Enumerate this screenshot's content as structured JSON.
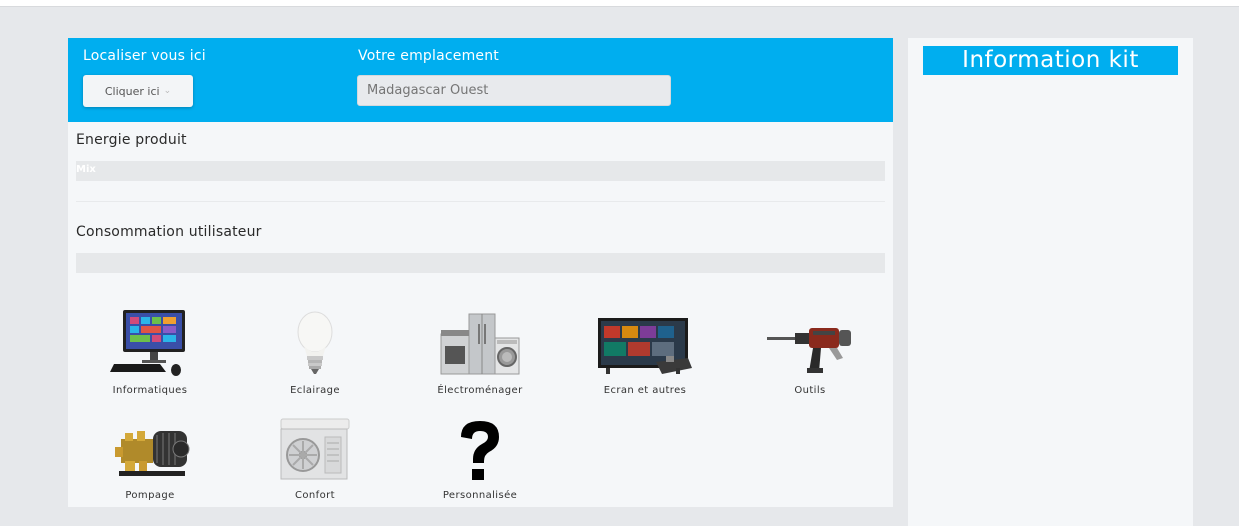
{
  "header": {
    "locate_label": "Localiser vous ici",
    "locate_button": "Cliquer ici",
    "location_label": "Votre emplacement",
    "location_placeholder": "Madagascar Ouest"
  },
  "energy": {
    "title": "Energie produit",
    "bar_text": "Mix"
  },
  "consumption": {
    "title": "Consommation utilisateur"
  },
  "categories": [
    {
      "label": "Informatiques",
      "icon": "computer-icon"
    },
    {
      "label": "Eclairage",
      "icon": "light-bulb-icon"
    },
    {
      "label": "Électroménager",
      "icon": "appliances-icon"
    },
    {
      "label": "Ecran et autres",
      "icon": "tv-screen-icon"
    },
    {
      "label": "Outils",
      "icon": "drill-icon"
    },
    {
      "label": "Pompage",
      "icon": "pump-icon"
    },
    {
      "label": "Confort",
      "icon": "air-conditioner-icon"
    },
    {
      "label": "Personnalisée",
      "icon": "question-mark-icon"
    }
  ],
  "sidebar": {
    "title": "Information kit"
  },
  "colors": {
    "accent": "#00aeef",
    "background": "#e6e8eb",
    "card": "#f5f7f9"
  }
}
